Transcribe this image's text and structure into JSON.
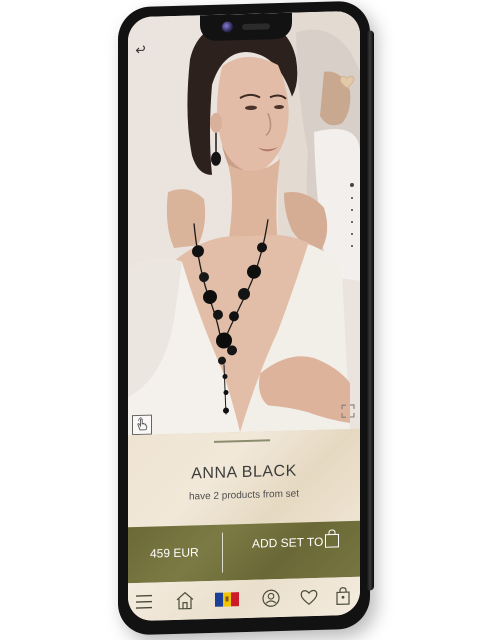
{
  "product": {
    "title": "ANNA BLACK",
    "subtitle": "have 2 products from set"
  },
  "action_bar": {
    "price": "459 EUR",
    "add_label": "ADD SET TO"
  },
  "gallery": {
    "image_count": 6,
    "active_index": 0
  },
  "icons": {
    "back": "back-arrow-icon",
    "favorite": "heart-icon",
    "gesture": "hand-tap-icon",
    "zoom": "expand-icon",
    "bag": "shopping-bag-icon",
    "nav": [
      "menu-icon",
      "home-icon",
      "flag-icon",
      "user-icon",
      "heart-icon",
      "bag-icon"
    ]
  },
  "colors": {
    "accent": "#6f6d3a",
    "panel": "#efe4d2",
    "text": "#3d3d3d"
  }
}
